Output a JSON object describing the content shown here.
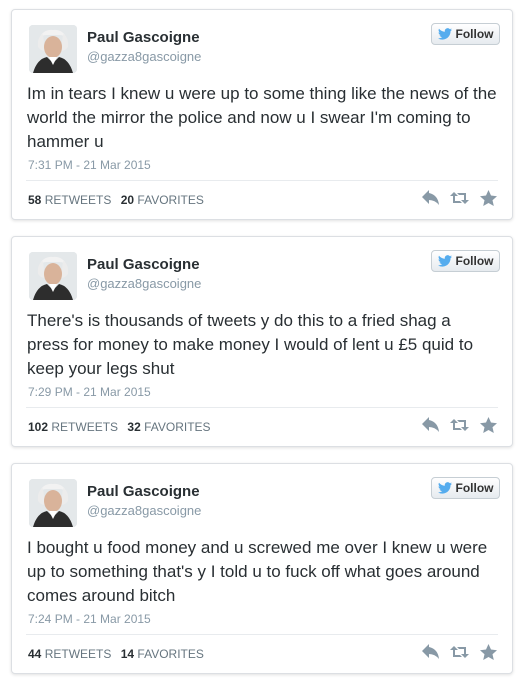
{
  "tweets": [
    {
      "name": "Paul Gascoigne",
      "handle": "@gazza8gascoigne",
      "follow_label": "Follow",
      "text": "Im in tears I knew u were up to some thing like the news of the world the mirror the police and now u I swear I'm coming to hammer u",
      "timestamp": "7:31 PM - 21 Mar 2015",
      "retweets": "58",
      "retweets_label": "RETWEETS",
      "favorites": "20",
      "favorites_label": "FAVORITES"
    },
    {
      "name": "Paul Gascoigne",
      "handle": "@gazza8gascoigne",
      "follow_label": "Follow",
      "text": "There's is thousands of tweets y do this to a fried shag a press for money to make money I would of lent u £5 quid to keep your legs shut",
      "timestamp": "7:29 PM - 21 Mar 2015",
      "retweets": "102",
      "retweets_label": "RETWEETS",
      "favorites": "32",
      "favorites_label": "FAVORITES"
    },
    {
      "name": "Paul Gascoigne",
      "handle": "@gazza8gascoigne",
      "follow_label": "Follow",
      "text": "I bought u food money and u screwed me over I knew u were up to something that's y I told u to fuck off what goes around comes around bitch",
      "timestamp": "7:24 PM - 21 Mar 2015",
      "retweets": "44",
      "retweets_label": "RETWEETS",
      "favorites": "14",
      "favorites_label": "FAVORITES"
    }
  ],
  "icons": {
    "follow": "twitter-bird-icon",
    "reply": "reply-icon",
    "retweet": "retweet-icon",
    "favorite": "star-icon"
  },
  "colors": {
    "twitter_blue": "#55acee",
    "action_gray": "#8899a6"
  }
}
